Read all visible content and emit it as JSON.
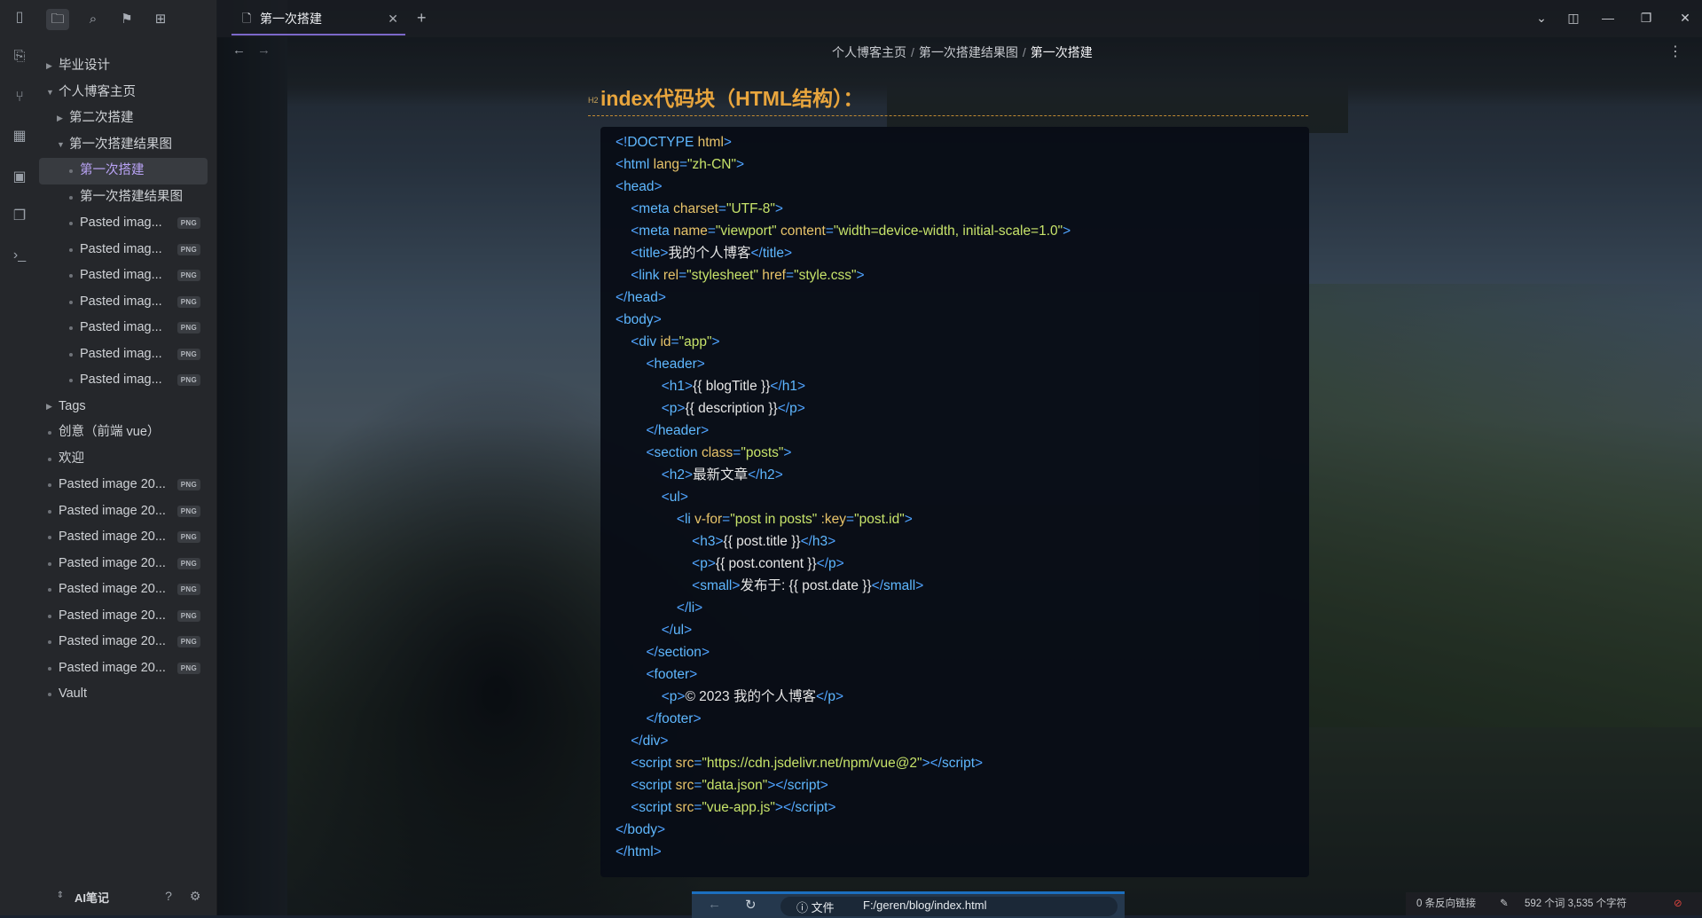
{
  "window": {
    "tab_title": "第一次搭建",
    "tab_icon": "document-icon"
  },
  "breadcrumb": [
    "个人博客主页",
    "第一次搭建结果图",
    "第一次搭建"
  ],
  "sidebar": {
    "items": [
      {
        "label": "毕业设计",
        "type": "folder-collapsed",
        "level": 0
      },
      {
        "label": "个人博客主页",
        "type": "folder-open",
        "level": 0
      },
      {
        "label": "第二次搭建",
        "type": "folder-collapsed",
        "level": 1
      },
      {
        "label": "第一次搭建结果图",
        "type": "folder-open",
        "level": 1
      },
      {
        "label": "第一次搭建",
        "type": "file",
        "level": 2,
        "active": true
      },
      {
        "label": "第一次搭建结果图",
        "type": "file",
        "level": 2
      },
      {
        "label": "Pasted imag...",
        "type": "file",
        "level": 2,
        "badge": "PNG"
      },
      {
        "label": "Pasted imag...",
        "type": "file",
        "level": 2,
        "badge": "PNG"
      },
      {
        "label": "Pasted imag...",
        "type": "file",
        "level": 2,
        "badge": "PNG"
      },
      {
        "label": "Pasted imag...",
        "type": "file",
        "level": 2,
        "badge": "PNG"
      },
      {
        "label": "Pasted imag...",
        "type": "file",
        "level": 2,
        "badge": "PNG"
      },
      {
        "label": "Pasted imag...",
        "type": "file",
        "level": 2,
        "badge": "PNG"
      },
      {
        "label": "Pasted imag...",
        "type": "file",
        "level": 2,
        "badge": "PNG"
      },
      {
        "label": "Tags",
        "type": "folder-collapsed",
        "level": 0
      },
      {
        "label": "创意（前端 vue）",
        "type": "file",
        "level": 0
      },
      {
        "label": "欢迎",
        "type": "file",
        "level": 0
      },
      {
        "label": "Pasted image 20...",
        "type": "file",
        "level": 0,
        "badge": "PNG"
      },
      {
        "label": "Pasted image 20...",
        "type": "file",
        "level": 0,
        "badge": "PNG"
      },
      {
        "label": "Pasted image 20...",
        "type": "file",
        "level": 0,
        "badge": "PNG"
      },
      {
        "label": "Pasted image 20...",
        "type": "file",
        "level": 0,
        "badge": "PNG"
      },
      {
        "label": "Pasted image 20...",
        "type": "file",
        "level": 0,
        "badge": "PNG"
      },
      {
        "label": "Pasted image 20...",
        "type": "file",
        "level": 0,
        "badge": "PNG"
      },
      {
        "label": "Pasted image 20...",
        "type": "file",
        "level": 0,
        "badge": "PNG"
      },
      {
        "label": "Pasted image 20...",
        "type": "file",
        "level": 0,
        "badge": "PNG"
      },
      {
        "label": "Vault",
        "type": "file",
        "level": 0
      }
    ],
    "vault_name": "AI笔记"
  },
  "heading": {
    "level_tag": "H2",
    "text": "index代码块（HTML结构）："
  },
  "code_lines": [
    [
      [
        "p",
        "<!"
      ],
      [
        "tg",
        "DOCTYPE"
      ],
      [
        "tx",
        " "
      ],
      [
        "at",
        "html"
      ],
      [
        "p",
        ">"
      ]
    ],
    [
      [
        "p",
        "<"
      ],
      [
        "tg",
        "html"
      ],
      [
        "tx",
        " "
      ],
      [
        "at",
        "lang"
      ],
      [
        "p",
        "="
      ],
      [
        "st",
        "\"zh-CN\""
      ],
      [
        "p",
        ">"
      ]
    ],
    [
      [
        "p",
        "<"
      ],
      [
        "tg",
        "head"
      ],
      [
        "p",
        ">"
      ]
    ],
    [
      [
        "tx",
        "    "
      ],
      [
        "p",
        "<"
      ],
      [
        "tg",
        "meta"
      ],
      [
        "tx",
        " "
      ],
      [
        "at",
        "charset"
      ],
      [
        "p",
        "="
      ],
      [
        "st",
        "\"UTF-8\""
      ],
      [
        "p",
        ">"
      ]
    ],
    [
      [
        "tx",
        "    "
      ],
      [
        "p",
        "<"
      ],
      [
        "tg",
        "meta"
      ],
      [
        "tx",
        " "
      ],
      [
        "at",
        "name"
      ],
      [
        "p",
        "="
      ],
      [
        "st",
        "\"viewport\""
      ],
      [
        "tx",
        " "
      ],
      [
        "at",
        "content"
      ],
      [
        "p",
        "="
      ],
      [
        "st",
        "\"width=device-width, initial-scale=1.0\""
      ],
      [
        "p",
        ">"
      ]
    ],
    [
      [
        "tx",
        "    "
      ],
      [
        "p",
        "<"
      ],
      [
        "tg",
        "title"
      ],
      [
        "p",
        ">"
      ],
      [
        "tx",
        "我的个人博客"
      ],
      [
        "p",
        "</"
      ],
      [
        "tg",
        "title"
      ],
      [
        "p",
        ">"
      ]
    ],
    [
      [
        "tx",
        "    "
      ],
      [
        "p",
        "<"
      ],
      [
        "tg",
        "link"
      ],
      [
        "tx",
        " "
      ],
      [
        "at",
        "rel"
      ],
      [
        "p",
        "="
      ],
      [
        "st",
        "\"stylesheet\""
      ],
      [
        "tx",
        " "
      ],
      [
        "at",
        "href"
      ],
      [
        "p",
        "="
      ],
      [
        "st",
        "\"style.css\""
      ],
      [
        "p",
        ">"
      ]
    ],
    [
      [
        "p",
        "</"
      ],
      [
        "tg",
        "head"
      ],
      [
        "p",
        ">"
      ]
    ],
    [
      [
        "p",
        "<"
      ],
      [
        "tg",
        "body"
      ],
      [
        "p",
        ">"
      ]
    ],
    [
      [
        "tx",
        "    "
      ],
      [
        "p",
        "<"
      ],
      [
        "tg",
        "div"
      ],
      [
        "tx",
        " "
      ],
      [
        "at",
        "id"
      ],
      [
        "p",
        "="
      ],
      [
        "st",
        "\"app\""
      ],
      [
        "p",
        ">"
      ]
    ],
    [
      [
        "tx",
        "        "
      ],
      [
        "p",
        "<"
      ],
      [
        "tg",
        "header"
      ],
      [
        "p",
        ">"
      ]
    ],
    [
      [
        "tx",
        "            "
      ],
      [
        "p",
        "<"
      ],
      [
        "tg",
        "h1"
      ],
      [
        "p",
        ">"
      ],
      [
        "tx",
        "{{ blogTitle }}"
      ],
      [
        "p",
        "</"
      ],
      [
        "tg",
        "h1"
      ],
      [
        "p",
        ">"
      ]
    ],
    [
      [
        "tx",
        "            "
      ],
      [
        "p",
        "<"
      ],
      [
        "tg",
        "p"
      ],
      [
        "p",
        ">"
      ],
      [
        "tx",
        "{{ description }}"
      ],
      [
        "p",
        "</"
      ],
      [
        "tg",
        "p"
      ],
      [
        "p",
        ">"
      ]
    ],
    [
      [
        "tx",
        "        "
      ],
      [
        "p",
        "</"
      ],
      [
        "tg",
        "header"
      ],
      [
        "p",
        ">"
      ]
    ],
    [
      [
        "tx",
        "        "
      ],
      [
        "p",
        "<"
      ],
      [
        "tg",
        "section"
      ],
      [
        "tx",
        " "
      ],
      [
        "at",
        "class"
      ],
      [
        "p",
        "="
      ],
      [
        "st",
        "\"posts\""
      ],
      [
        "p",
        ">"
      ]
    ],
    [
      [
        "tx",
        "            "
      ],
      [
        "p",
        "<"
      ],
      [
        "tg",
        "h2"
      ],
      [
        "p",
        ">"
      ],
      [
        "tx",
        "最新文章"
      ],
      [
        "p",
        "</"
      ],
      [
        "tg",
        "h2"
      ],
      [
        "p",
        ">"
      ]
    ],
    [
      [
        "tx",
        "            "
      ],
      [
        "p",
        "<"
      ],
      [
        "tg",
        "ul"
      ],
      [
        "p",
        ">"
      ]
    ],
    [
      [
        "tx",
        "                "
      ],
      [
        "p",
        "<"
      ],
      [
        "tg",
        "li"
      ],
      [
        "tx",
        " "
      ],
      [
        "at",
        "v-for"
      ],
      [
        "p",
        "="
      ],
      [
        "st",
        "\"post in posts\""
      ],
      [
        "tx",
        " "
      ],
      [
        "at",
        ":key"
      ],
      [
        "p",
        "="
      ],
      [
        "st",
        "\"post.id\""
      ],
      [
        "p",
        ">"
      ]
    ],
    [
      [
        "tx",
        "                    "
      ],
      [
        "p",
        "<"
      ],
      [
        "tg",
        "h3"
      ],
      [
        "p",
        ">"
      ],
      [
        "tx",
        "{{ post.title }}"
      ],
      [
        "p",
        "</"
      ],
      [
        "tg",
        "h3"
      ],
      [
        "p",
        ">"
      ]
    ],
    [
      [
        "tx",
        "                    "
      ],
      [
        "p",
        "<"
      ],
      [
        "tg",
        "p"
      ],
      [
        "p",
        ">"
      ],
      [
        "tx",
        "{{ post.content }}"
      ],
      [
        "p",
        "</"
      ],
      [
        "tg",
        "p"
      ],
      [
        "p",
        ">"
      ]
    ],
    [
      [
        "tx",
        "                    "
      ],
      [
        "p",
        "<"
      ],
      [
        "tg",
        "small"
      ],
      [
        "p",
        ">"
      ],
      [
        "tx",
        "发布于: {{ post.date }}"
      ],
      [
        "p",
        "</"
      ],
      [
        "tg",
        "small"
      ],
      [
        "p",
        ">"
      ]
    ],
    [
      [
        "tx",
        "                "
      ],
      [
        "p",
        "</"
      ],
      [
        "tg",
        "li"
      ],
      [
        "p",
        ">"
      ]
    ],
    [
      [
        "tx",
        "            "
      ],
      [
        "p",
        "</"
      ],
      [
        "tg",
        "ul"
      ],
      [
        "p",
        ">"
      ]
    ],
    [
      [
        "tx",
        "        "
      ],
      [
        "p",
        "</"
      ],
      [
        "tg",
        "section"
      ],
      [
        "p",
        ">"
      ]
    ],
    [
      [
        "tx",
        "        "
      ],
      [
        "p",
        "<"
      ],
      [
        "tg",
        "footer"
      ],
      [
        "p",
        ">"
      ]
    ],
    [
      [
        "tx",
        "            "
      ],
      [
        "p",
        "<"
      ],
      [
        "tg",
        "p"
      ],
      [
        "p",
        ">"
      ],
      [
        "tx",
        "© 2023 我的个人博客"
      ],
      [
        "p",
        "</"
      ],
      [
        "tg",
        "p"
      ],
      [
        "p",
        ">"
      ]
    ],
    [
      [
        "tx",
        "        "
      ],
      [
        "p",
        "</"
      ],
      [
        "tg",
        "footer"
      ],
      [
        "p",
        ">"
      ]
    ],
    [
      [
        "tx",
        "    "
      ],
      [
        "p",
        "</"
      ],
      [
        "tg",
        "div"
      ],
      [
        "p",
        ">"
      ]
    ],
    [
      [
        "tx",
        "    "
      ],
      [
        "p",
        "<"
      ],
      [
        "tg",
        "script"
      ],
      [
        "tx",
        " "
      ],
      [
        "at",
        "src"
      ],
      [
        "p",
        "="
      ],
      [
        "st",
        "\"https://cdn.jsdelivr.net/npm/vue@2\""
      ],
      [
        "p",
        "></"
      ],
      [
        "tg",
        "script"
      ],
      [
        "p",
        ">"
      ]
    ],
    [
      [
        "tx",
        "    "
      ],
      [
        "p",
        "<"
      ],
      [
        "tg",
        "script"
      ],
      [
        "tx",
        " "
      ],
      [
        "at",
        "src"
      ],
      [
        "p",
        "="
      ],
      [
        "st",
        "\"data.json\""
      ],
      [
        "p",
        "></"
      ],
      [
        "tg",
        "script"
      ],
      [
        "p",
        ">"
      ]
    ],
    [
      [
        "tx",
        "    "
      ],
      [
        "p",
        "<"
      ],
      [
        "tg",
        "script"
      ],
      [
        "tx",
        " "
      ],
      [
        "at",
        "src"
      ],
      [
        "p",
        "="
      ],
      [
        "st",
        "\"vue-app.js\""
      ],
      [
        "p",
        "></"
      ],
      [
        "tg",
        "script"
      ],
      [
        "p",
        ">"
      ]
    ],
    [
      [
        "p",
        "</"
      ],
      [
        "tg",
        "body"
      ],
      [
        "p",
        ">"
      ]
    ],
    [
      [
        "p",
        "</"
      ],
      [
        "tg",
        "html"
      ],
      [
        "p",
        ">"
      ]
    ]
  ],
  "browser_strip": {
    "info_label": "文件",
    "url": "F:/geren/blog/index.html"
  },
  "status_bar": {
    "backlinks": "0 条反向链接",
    "counts": "592 个词  3,535 个字符"
  },
  "colors": {
    "accent": "#7c68c9",
    "heading": "#e8a53d",
    "code_bg": "#080d16",
    "tag": "#5fb8ff",
    "attr": "#e8c46a",
    "string": "#c7e36a"
  }
}
